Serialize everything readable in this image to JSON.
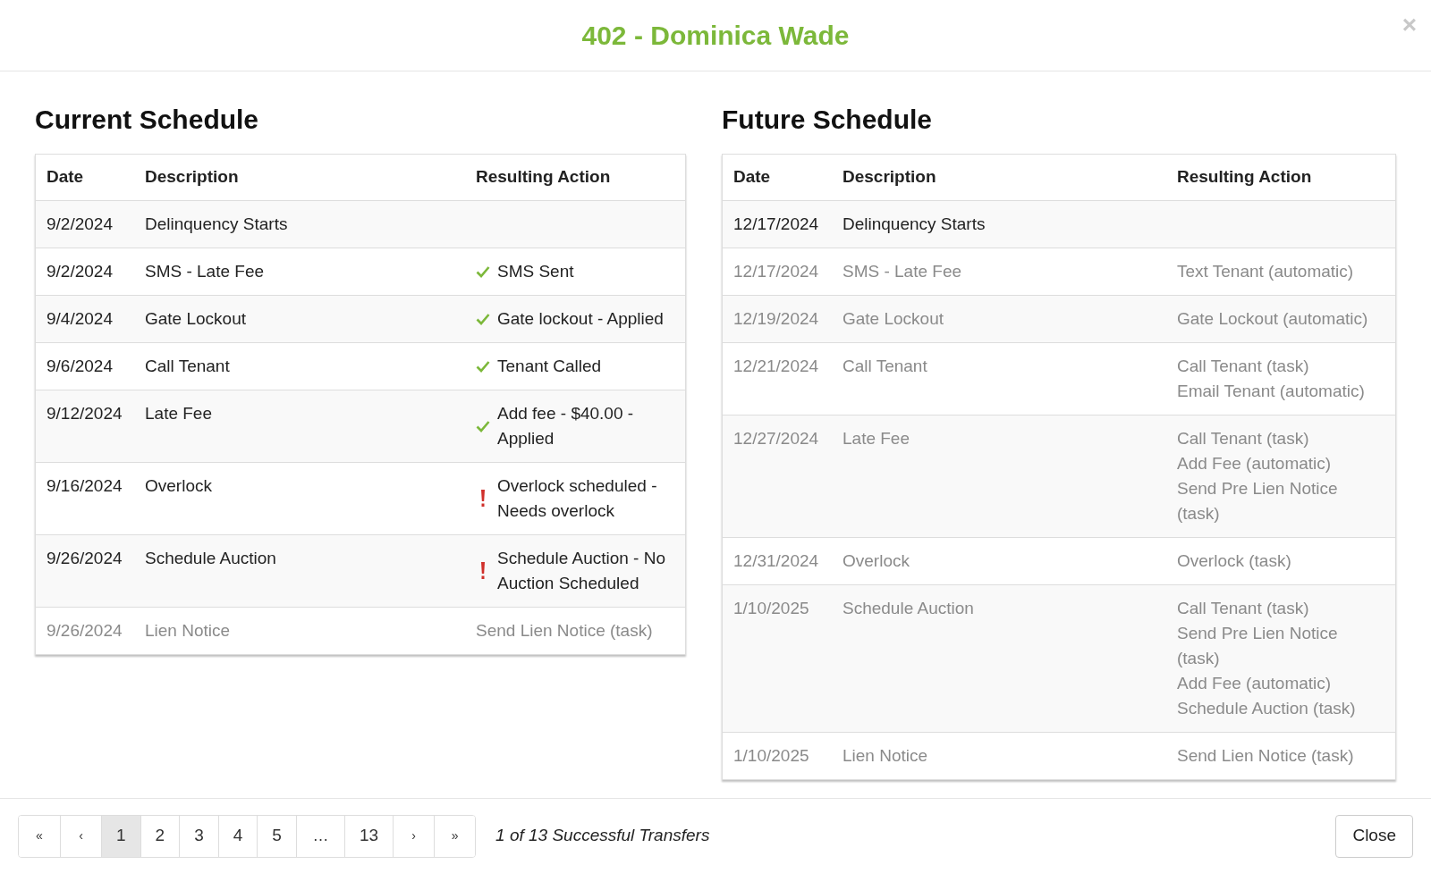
{
  "title": "402 - Dominica Wade",
  "close_icon": "×",
  "schedules": [
    {
      "heading": "Current Schedule",
      "columns": [
        "Date",
        "Description",
        "Resulting Action"
      ],
      "rows": [
        {
          "date": "9/2/2024",
          "description": "Delinquency Starts",
          "muted": false
        },
        {
          "date": "9/2/2024",
          "description": "SMS - Late Fee",
          "muted": false,
          "kind": "check",
          "actions": [
            "SMS Sent"
          ]
        },
        {
          "date": "9/4/2024",
          "description": "Gate Lockout",
          "muted": false,
          "kind": "check",
          "actions": [
            "Gate lockout - Applied"
          ]
        },
        {
          "date": "9/6/2024",
          "description": "Call Tenant",
          "muted": false,
          "kind": "check",
          "actions": [
            "Tenant Called"
          ]
        },
        {
          "date": "9/12/2024",
          "description": "Late Fee",
          "muted": false,
          "kind": "check",
          "actions": [
            "Add fee - $40.00 - Applied"
          ]
        },
        {
          "date": "9/16/2024",
          "description": "Overlock",
          "muted": false,
          "kind": "alert",
          "actions": [
            "Overlock scheduled - Needs overlock"
          ]
        },
        {
          "date": "9/26/2024",
          "description": "Schedule Auction",
          "muted": false,
          "kind": "alert",
          "actions": [
            "Schedule Auction - No Auction Scheduled"
          ]
        },
        {
          "date": "9/26/2024",
          "description": "Lien Notice",
          "muted": true,
          "actions": [
            "Send Lien Notice (task)"
          ]
        }
      ]
    },
    {
      "heading": "Future Schedule",
      "columns": [
        "Date",
        "Description",
        "Resulting Action"
      ],
      "rows": [
        {
          "date": "12/17/2024",
          "description": "Delinquency Starts",
          "muted": false
        },
        {
          "date": "12/17/2024",
          "description": "SMS - Late Fee",
          "muted": true,
          "actions": [
            "Text Tenant (automatic)"
          ]
        },
        {
          "date": "12/19/2024",
          "description": "Gate Lockout",
          "muted": true,
          "actions": [
            "Gate Lockout (automatic)"
          ]
        },
        {
          "date": "12/21/2024",
          "description": "Call Tenant",
          "muted": true,
          "actions": [
            "Call Tenant (task)",
            "Email Tenant (automatic)"
          ]
        },
        {
          "date": "12/27/2024",
          "description": "Late Fee",
          "muted": true,
          "actions": [
            "Call Tenant (task)",
            "Add Fee (automatic)",
            "Send Pre Lien Notice (task)"
          ]
        },
        {
          "date": "12/31/2024",
          "description": "Overlock",
          "muted": true,
          "actions": [
            "Overlock (task)"
          ]
        },
        {
          "date": "1/10/2025",
          "description": "Schedule Auction",
          "muted": true,
          "actions": [
            "Call Tenant (task)",
            "Send Pre Lien Notice (task)",
            "Add Fee (automatic)",
            "Schedule Auction (task)"
          ]
        },
        {
          "date": "1/10/2025",
          "description": "Lien Notice",
          "muted": true,
          "actions": [
            "Send Lien Notice (task)"
          ]
        }
      ]
    }
  ],
  "pagination": [
    {
      "label": "«",
      "kind": "first",
      "selected": false
    },
    {
      "label": "‹",
      "kind": "prev",
      "selected": false
    },
    {
      "label": "1",
      "kind": "page",
      "selected": true
    },
    {
      "label": "2",
      "kind": "page",
      "selected": false
    },
    {
      "label": "3",
      "kind": "page",
      "selected": false
    },
    {
      "label": "4",
      "kind": "page",
      "selected": false
    },
    {
      "label": "5",
      "kind": "page",
      "selected": false
    },
    {
      "label": "…",
      "kind": "gap",
      "selected": false
    },
    {
      "label": "13",
      "kind": "page",
      "selected": false
    },
    {
      "label": "›",
      "kind": "next",
      "selected": false
    },
    {
      "label": "»",
      "kind": "last",
      "selected": false
    }
  ],
  "pagination_summary": "1 of 13 Successful Transfers",
  "close_button": "Close"
}
